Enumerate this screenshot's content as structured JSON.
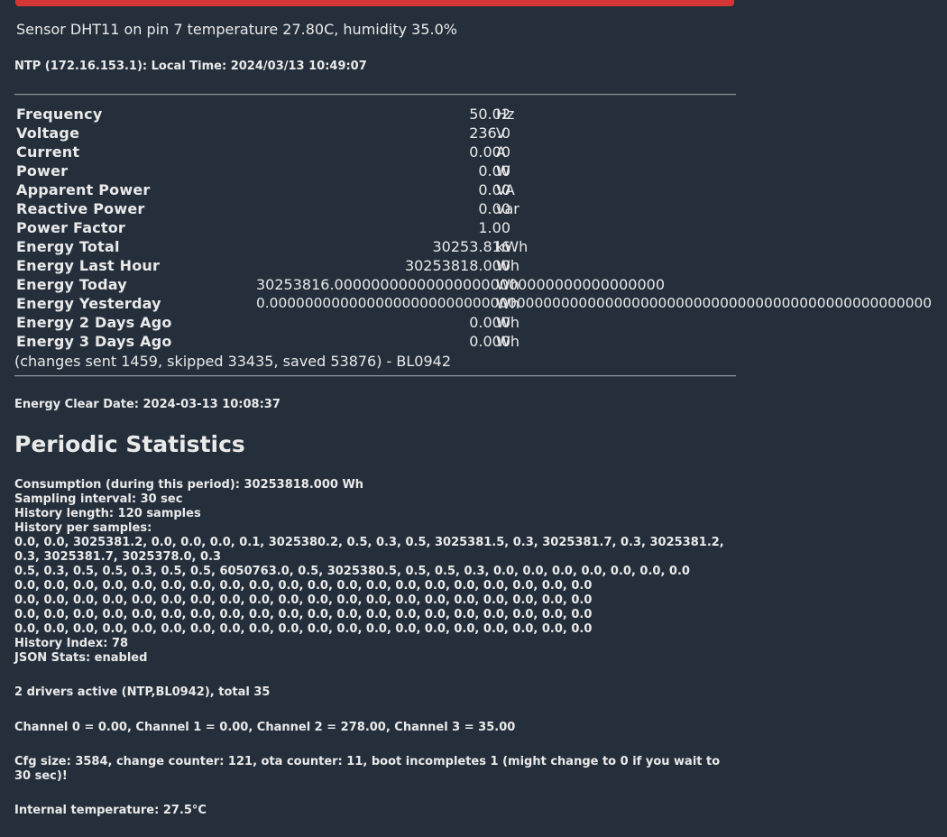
{
  "colors": {
    "background": "#252f3b",
    "accent_bar": "#d43535",
    "text": "#eaeaea"
  },
  "sensor_text": "Sensor DHT11 on pin 7 temperature 27.80C, humidity 35.0%",
  "ntp_text": "NTP (172.16.153.1): Local Time: 2024/03/13 10:49:07",
  "measurements": [
    {
      "label": "Frequency",
      "value": "50.02",
      "unit": "Hz"
    },
    {
      "label": "Voltage",
      "value": "236.0",
      "unit": "V"
    },
    {
      "label": "Current",
      "value": "0.000",
      "unit": "A"
    },
    {
      "label": "Power",
      "value": "0.00",
      "unit": "W"
    },
    {
      "label": "Apparent Power",
      "value": "0.00",
      "unit": "VA"
    },
    {
      "label": "Reactive Power",
      "value": "0.00",
      "unit": "var"
    },
    {
      "label": "Power Factor",
      "value": "1.00",
      "unit": ""
    },
    {
      "label": "Energy Total",
      "value": "30253.816",
      "unit": "kWh"
    },
    {
      "label": "Energy Last Hour",
      "value": "30253818.000",
      "unit": "Wh"
    },
    {
      "label": "Energy Today",
      "value": "30253816.000000000000000000000000000000000000",
      "unit": "Wh"
    },
    {
      "label": "Energy Yesterday",
      "value": "0.000000000000000000000000000000000000000000000000000000000000000000000000000",
      "unit": "Wh"
    },
    {
      "label": "Energy 2 Days Ago",
      "value": "0.000",
      "unit": "Wh"
    },
    {
      "label": "Energy 3 Days Ago",
      "value": "0.000",
      "unit": "Wh"
    }
  ],
  "changes_text": "(changes sent 1459, skipped 33435, saved 53876) - BL0942",
  "energy_clear_date": "Energy Clear Date: 2024-03-13 10:08:37",
  "periodic": {
    "title": "Periodic Statistics",
    "lines": [
      "Consumption (during this period): 30253818.000 Wh",
      "Sampling interval: 30 sec",
      "History length: 120 samples",
      "History per samples:",
      "0.0, 0.0, 3025381.2, 0.0, 0.0, 0.0, 0.1, 3025380.2, 0.5, 0.3, 0.5, 3025381.5, 0.3, 3025381.7, 0.3, 3025381.2,",
      "0.3, 3025381.7, 3025378.0, 0.3",
      "0.5, 0.3, 0.5, 0.5, 0.3, 0.5, 0.5, 6050763.0, 0.5, 3025380.5, 0.5, 0.5, 0.3, 0.0, 0.0, 0.0, 0.0, 0.0, 0.0, 0.0",
      "0.0, 0.0, 0.0, 0.0, 0.0, 0.0, 0.0, 0.0, 0.0, 0.0, 0.0, 0.0, 0.0, 0.0, 0.0, 0.0, 0.0, 0.0, 0.0, 0.0",
      "0.0, 0.0, 0.0, 0.0, 0.0, 0.0, 0.0, 0.0, 0.0, 0.0, 0.0, 0.0, 0.0, 0.0, 0.0, 0.0, 0.0, 0.0, 0.0, 0.0",
      "0.0, 0.0, 0.0, 0.0, 0.0, 0.0, 0.0, 0.0, 0.0, 0.0, 0.0, 0.0, 0.0, 0.0, 0.0, 0.0, 0.0, 0.0, 0.0, 0.0",
      "0.0, 0.0, 0.0, 0.0, 0.0, 0.0, 0.0, 0.0, 0.0, 0.0, 0.0, 0.0, 0.0, 0.0, 0.0, 0.0, 0.0, 0.0, 0.0, 0.0",
      "History Index: 78",
      "JSON Stats: enabled"
    ]
  },
  "drivers_text": "2 drivers active (NTP,BL0942), total 35",
  "channels_text": "Channel 0 = 0.00, Channel 1 = 0.00, Channel 2 = 278.00, Channel 3 = 35.00",
  "cfg_text": "Cfg size: 3584, change counter: 121, ota counter: 11, boot incompletes 1 (might change to 0 if you wait to 30 sec)!",
  "internal_temp_text": "Internal temperature: 27.5°C"
}
